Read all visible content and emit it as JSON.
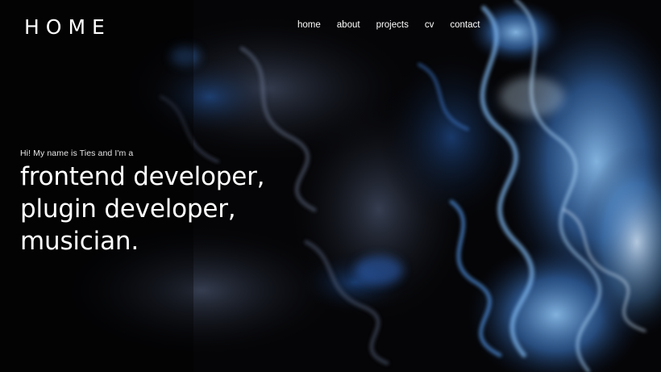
{
  "header": {
    "logo": "HOME"
  },
  "nav": {
    "items": [
      {
        "label": "home"
      },
      {
        "label": "about"
      },
      {
        "label": "projects"
      },
      {
        "label": "cv"
      },
      {
        "label": "contact"
      }
    ]
  },
  "hero": {
    "intro": "Hi! My name is Ties and I'm a",
    "roles": [
      "frontend developer,",
      "plugin developer,",
      "musician"
    ],
    "terminator": "."
  },
  "theme": {
    "background": "#050507",
    "accent_blue": "#3f7fd0",
    "text": "#ffffff"
  }
}
